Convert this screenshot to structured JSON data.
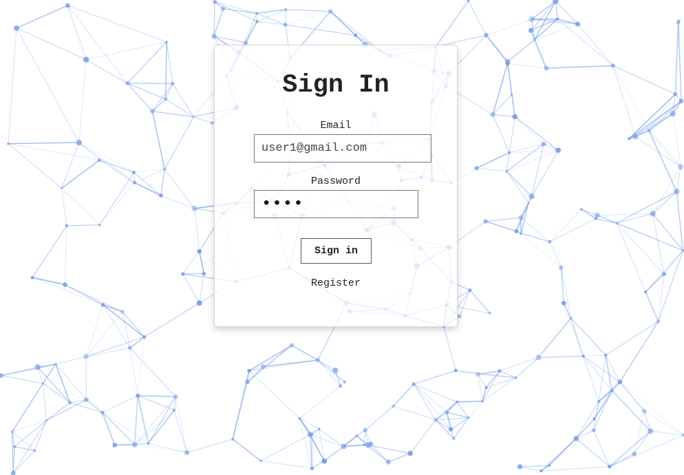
{
  "background": {
    "name": "network-graph-background",
    "line_color": "#7aa3f0",
    "node_color": "#6f97ee"
  },
  "login": {
    "title": "Sign In",
    "email_label": "Email",
    "email_value": "user1@gmail.com",
    "password_label": "Password",
    "password_value": "1234",
    "submit_label": "Sign in",
    "register_link": "Register"
  }
}
